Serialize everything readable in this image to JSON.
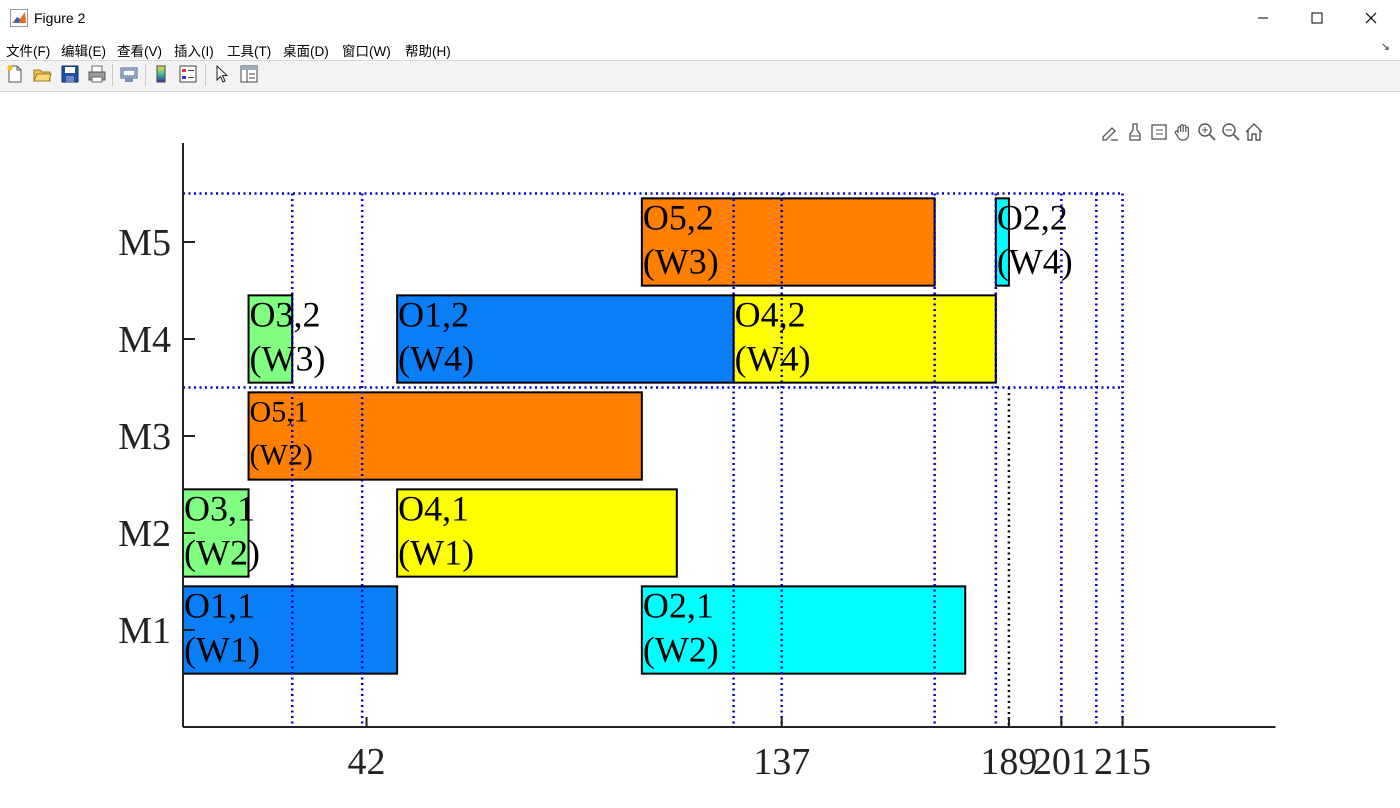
{
  "window": {
    "title": "Figure 2",
    "controls": [
      "minimize-icon",
      "maximize-icon",
      "close-icon"
    ]
  },
  "menu": [
    "文件(F)",
    "编辑(E)",
    "查看(V)",
    "插入(I)",
    "工具(T)",
    "桌面(D)",
    "窗口(W)",
    "帮助(H)"
  ],
  "toolbar": [
    "new-figure-icon",
    "open-file-icon",
    "save-icon",
    "print-icon",
    "link-plot-icon",
    "colorbar-icon",
    "legend-icon",
    "pointer-icon",
    "property-inspector-icon"
  ],
  "axes_toolbar": [
    "brush-edit-icon",
    "data-tips-icon",
    "datacursor-icon",
    "pan-icon",
    "zoom-in-icon",
    "zoom-out-icon",
    "home-icon"
  ],
  "chart_data": {
    "type": "gantt",
    "title": "",
    "xlabel": "",
    "ylabel": "",
    "xlim": [
      0,
      250
    ],
    "machines": [
      "M1",
      "M2",
      "M3",
      "M4",
      "M5"
    ],
    "xticks": [
      "42",
      "137",
      "189",
      "201",
      "215"
    ],
    "tasks": [
      {
        "machine": "M1",
        "start": 0,
        "end": 49,
        "label1": "O1,1",
        "label2": "(W1)",
        "color": "#0a7ef7"
      },
      {
        "machine": "M1",
        "start": 105,
        "end": 179,
        "label1": "O2,1",
        "label2": "(W2)",
        "color": "#00ffff"
      },
      {
        "machine": "M2",
        "start": 0,
        "end": 15,
        "label1": "O3,1",
        "label2": "(W2)",
        "color": "#80ff80"
      },
      {
        "machine": "M2",
        "start": 49,
        "end": 113,
        "label1": "O4,1",
        "label2": "(W1)",
        "color": "#ffff00"
      },
      {
        "machine": "M3",
        "start": 15,
        "end": 105,
        "label1": "O5,1",
        "label2": "(W2)",
        "color": "#ff8000"
      },
      {
        "machine": "M4",
        "start": 15,
        "end": 25,
        "label1": "O3,2",
        "label2": "(W3)",
        "color": "#80ff80"
      },
      {
        "machine": "M4",
        "start": 49,
        "end": 126,
        "label1": "O1,2",
        "label2": "(W4)",
        "color": "#0a7ef7"
      },
      {
        "machine": "M4",
        "start": 126,
        "end": 186,
        "label1": "O4,2",
        "label2": "(W4)",
        "color": "#ffff00"
      },
      {
        "machine": "M5",
        "start": 105,
        "end": 172,
        "label1": "O5,2",
        "label2": "(W3)",
        "color": "#ff8000"
      },
      {
        "machine": "M5",
        "start": 186,
        "end": 189,
        "label1": "O2,2",
        "label2": "(W4)",
        "color": "#00ffff"
      }
    ],
    "blue_vlines": [
      25,
      41,
      126,
      137,
      172,
      186,
      201,
      209,
      215
    ],
    "black_vline": 189,
    "hlines_machine_edges": [
      3.5,
      5.5
    ]
  }
}
